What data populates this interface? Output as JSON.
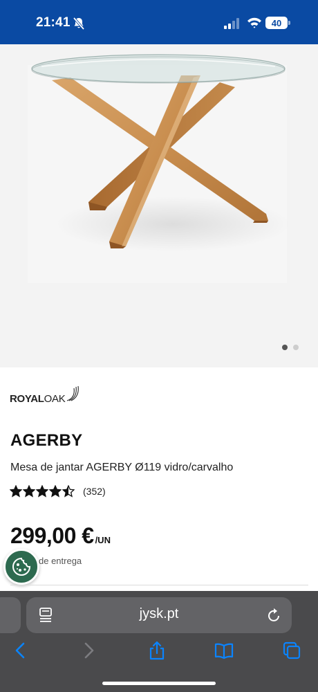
{
  "status_bar": {
    "time": "21:41",
    "battery": "40",
    "icons": [
      "bell-slash-icon",
      "signal-icon",
      "wifi-icon",
      "battery-icon"
    ],
    "background": "#0a4aa3"
  },
  "gallery": {
    "image": "glass-round-dining-table-oak-legs",
    "page_count": 2,
    "active_page": 1
  },
  "product": {
    "brand": {
      "part1": "ROYAL",
      "part2": "OAK"
    },
    "name": "AGERBY",
    "description": "Mesa de jantar AGERBY Ø119 vidro/carvalho",
    "rating": 4.5,
    "rating_max": 5,
    "review_count": "(352)",
    "price": "299,00 €",
    "price_unit": "/UN",
    "delivery_partial": "de entrega"
  },
  "cookie_button": {
    "icon": "cookie-icon",
    "color": "#2d6a4f"
  },
  "browser": {
    "url": "jysk.pt",
    "icons": [
      "reader-icon",
      "reload-icon",
      "back-icon",
      "forward-icon",
      "share-icon",
      "bookmarks-icon",
      "tabs-icon"
    ],
    "accent": "#0a84ff"
  }
}
